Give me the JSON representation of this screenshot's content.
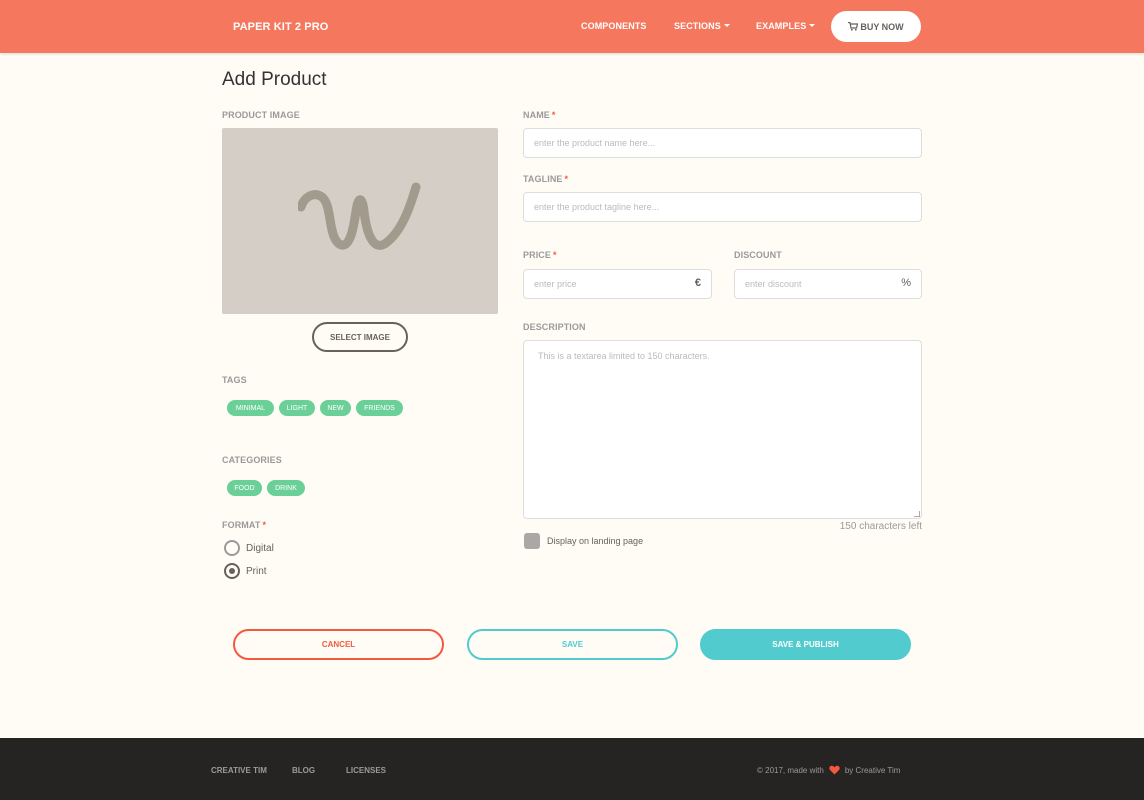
{
  "navbar": {
    "brand": "PAPER KIT 2 PRO",
    "links": [
      {
        "label": "COMPONENTS"
      },
      {
        "label": "SECTIONS"
      },
      {
        "label": "EXAMPLES"
      }
    ],
    "buy_label": "BUY NOW",
    "bg_color": "#f5775e"
  },
  "page_title": "Add Product",
  "product_image": {
    "label": "PRODUCT IMAGE",
    "select_label": "SELECT IMAGE"
  },
  "tags": {
    "label": "TAGS",
    "items": [
      "MINIMAL",
      "LIGHT",
      "NEW",
      "FRIENDS"
    ]
  },
  "categories": {
    "label": "CATEGORIES",
    "items": [
      "FOOD",
      "DRINK"
    ]
  },
  "format": {
    "label": "FORMAT",
    "required_mark": "*",
    "options": [
      {
        "label": "Digital",
        "checked": false
      },
      {
        "label": "Print",
        "checked": true
      }
    ]
  },
  "name": {
    "label": "NAME",
    "required_mark": "*",
    "placeholder": "enter the product name here..."
  },
  "tagline": {
    "label": "TAGLINE",
    "required_mark": "*",
    "placeholder": "enter the product tagline here..."
  },
  "price": {
    "label": "PRICE",
    "required_mark": "*",
    "placeholder": "enter price",
    "addon": "€"
  },
  "discount": {
    "label": "DISCOUNT",
    "placeholder": "enter discount",
    "addon": "%"
  },
  "description": {
    "label": "DESCRIPTION",
    "placeholder": "This is a textarea limited to 150 characters.",
    "chars_left": "150 characters left"
  },
  "landing": {
    "label": "Display on landing page",
    "checked": false
  },
  "actions": {
    "cancel": "CANCEL",
    "save": "SAVE",
    "publish": "SAVE & PUBLISH"
  },
  "footer": {
    "links": [
      "CREATIVE TIM",
      "BLOG",
      "LICENSES"
    ],
    "copy_prefix": "© 2017, made with",
    "copy_suffix": "by Creative Tim"
  },
  "colors": {
    "primary": "#f5775e",
    "danger": "#f5593d",
    "info": "#51cbce",
    "success": "#6bd098",
    "footer_bg": "#252422"
  }
}
